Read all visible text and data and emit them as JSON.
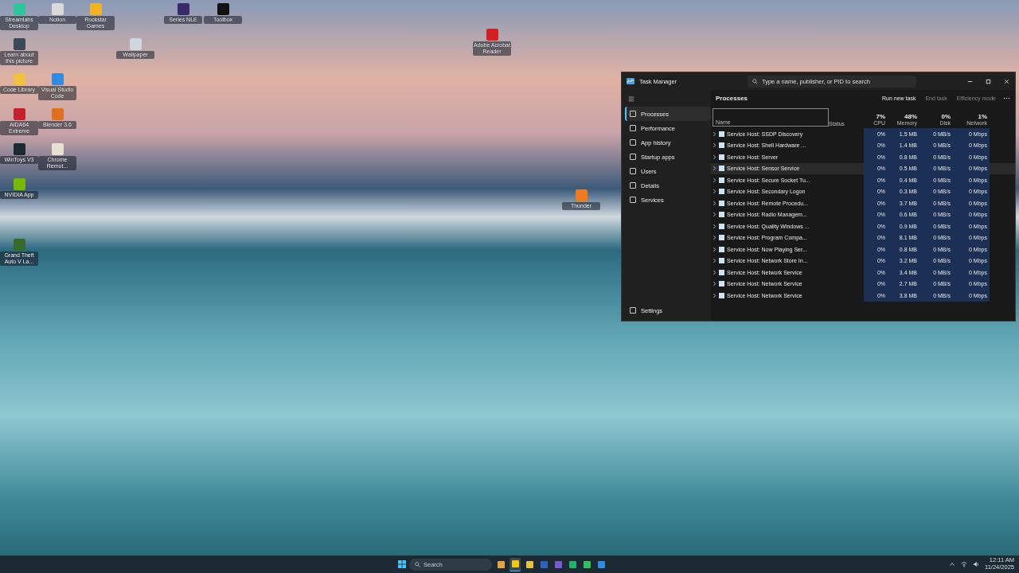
{
  "desktop_icons": [
    {
      "label": "Streamlabs Desktop"
    },
    {
      "label": "Notion"
    },
    {
      "label": "Rockstar Games"
    },
    {
      "label": "Learn about this picture"
    },
    {
      "label": "Wallpaper"
    },
    {
      "label": "Code Library"
    },
    {
      "label": "Visual Studio Code"
    },
    {
      "label": "AIDA64 Extreme"
    },
    {
      "label": "Blender 3.6"
    },
    {
      "label": "WinToys V3"
    },
    {
      "label": "Chrome Remot..."
    },
    {
      "label": "NVIDIA App"
    },
    {
      "label": "Grand Theft Auto V La..."
    },
    {
      "label": "Series NLE"
    },
    {
      "label": "Toolbox"
    },
    {
      "label": "Adobe Acrobat Reader"
    },
    {
      "label": "Thunder"
    }
  ],
  "task_manager": {
    "title": "Task Manager",
    "search": {
      "placeholder": "Type a name, publisher, or PID to search"
    },
    "nav": [
      {
        "label": "Processes",
        "selected": true
      },
      {
        "label": "Performance",
        "selected": false
      },
      {
        "label": "App history",
        "selected": false
      },
      {
        "label": "Startup apps",
        "selected": false
      },
      {
        "label": "Users",
        "selected": false
      },
      {
        "label": "Details",
        "selected": false
      },
      {
        "label": "Services",
        "selected": false
      }
    ],
    "settings": "Settings",
    "page_title": "Processes",
    "toolbar": [
      {
        "label": "Run new task",
        "disabled": false
      },
      {
        "label": "End task",
        "disabled": true
      },
      {
        "label": "Efficiency mode",
        "disabled": true
      }
    ],
    "columns": [
      {
        "label": "Name"
      },
      {
        "label": "Status"
      },
      {
        "percent": "7%",
        "label": "CPU"
      },
      {
        "percent": "48%",
        "label": "Memory"
      },
      {
        "percent": "0%",
        "label": "Disk"
      },
      {
        "percent": "1%",
        "label": "Network"
      }
    ],
    "rows": [
      {
        "name": "Service Host: SSDP Discovery",
        "cpu": "0%",
        "memory": "1.5 MB",
        "disk": "0 MB/s",
        "network": "0 Mbps",
        "selected": false
      },
      {
        "name": "Service Host: Shell Hardware ...",
        "cpu": "0%",
        "memory": "1.4 MB",
        "disk": "0 MB/s",
        "network": "0 Mbps",
        "selected": false
      },
      {
        "name": "Service Host: Server",
        "cpu": "0%",
        "memory": "0.8 MB",
        "disk": "0 MB/s",
        "network": "0 Mbps",
        "selected": false
      },
      {
        "name": "Service Host: Sensor Service",
        "cpu": "0%",
        "memory": "0.5 MB",
        "disk": "0 MB/s",
        "network": "0 Mbps",
        "selected": true
      },
      {
        "name": "Service Host: Secure Socket Tu...",
        "cpu": "0%",
        "memory": "0.4 MB",
        "disk": "0 MB/s",
        "network": "0 Mbps",
        "selected": false
      },
      {
        "name": "Service Host: Secondary Logon",
        "cpu": "0%",
        "memory": "0.3 MB",
        "disk": "0 MB/s",
        "network": "0 Mbps",
        "selected": false
      },
      {
        "name": "Service Host: Remote Procedu...",
        "cpu": "0%",
        "memory": "3.7 MB",
        "disk": "0 MB/s",
        "network": "0 Mbps",
        "selected": false
      },
      {
        "name": "Service Host: Radio Managem...",
        "cpu": "0%",
        "memory": "0.6 MB",
        "disk": "0 MB/s",
        "network": "0 Mbps",
        "selected": false
      },
      {
        "name": "Service Host: Quality Windows ...",
        "cpu": "0%",
        "memory": "0.9 MB",
        "disk": "0 MB/s",
        "network": "0 Mbps",
        "selected": false
      },
      {
        "name": "Service Host: Program Compa...",
        "cpu": "0%",
        "memory": "8.1 MB",
        "disk": "0 MB/s",
        "network": "0 Mbps",
        "selected": false
      },
      {
        "name": "Service Host: Now Playing Ser...",
        "cpu": "0%",
        "memory": "0.8 MB",
        "disk": "0 MB/s",
        "network": "0 Mbps",
        "selected": false
      },
      {
        "name": "Service Host: Network Store In...",
        "cpu": "0%",
        "memory": "3.2 MB",
        "disk": "0 MB/s",
        "network": "0 Mbps",
        "selected": false
      },
      {
        "name": "Service Host: Network Service",
        "cpu": "0%",
        "memory": "3.4 MB",
        "disk": "0 MB/s",
        "network": "0 Mbps",
        "selected": false
      },
      {
        "name": "Service Host: Network Service",
        "cpu": "0%",
        "memory": "2.7 MB",
        "disk": "0 MB/s",
        "network": "0 Mbps",
        "selected": false
      },
      {
        "name": "Service Host: Network Service",
        "cpu": "0%",
        "memory": "3.8 MB",
        "disk": "0 MB/s",
        "network": "0 Mbps",
        "selected": false
      }
    ]
  },
  "taskbar": {
    "search": {
      "placeholder": "Search"
    },
    "apps": [
      {
        "selected": false
      },
      {
        "selected": true
      },
      {
        "selected": false
      },
      {
        "selected": false
      },
      {
        "selected": false
      },
      {
        "selected": false
      },
      {
        "selected": false
      },
      {
        "selected": false
      }
    ],
    "time": "12:11 AM",
    "date": "11/24/2025"
  }
}
